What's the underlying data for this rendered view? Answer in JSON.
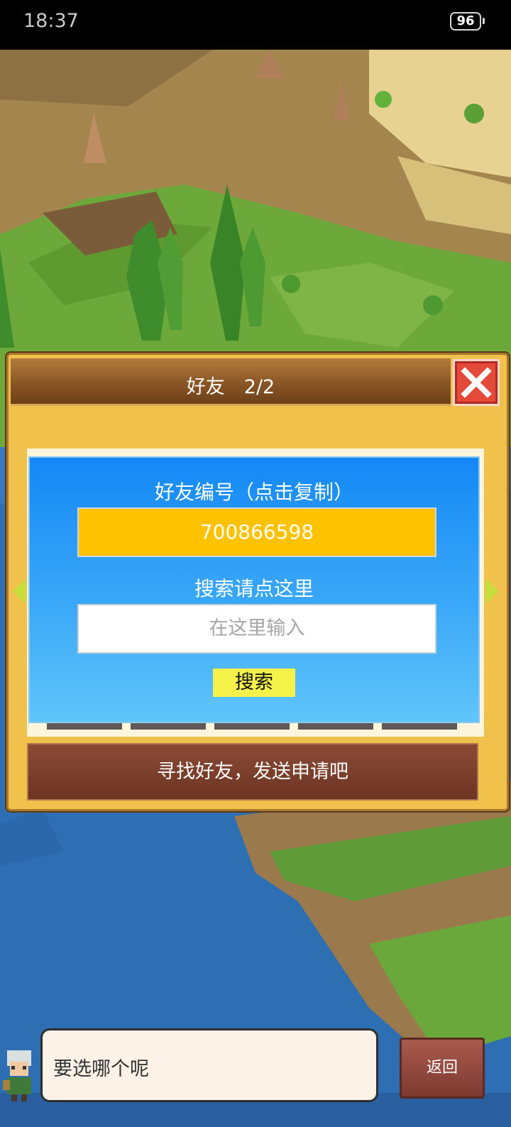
{
  "status_bar": {
    "time": "18:37",
    "battery": "96"
  },
  "panel": {
    "title": "好友　2/2",
    "friend_id_label": "好友编号（点击复制）",
    "friend_id": "700866598",
    "search_label": "搜索请点这里",
    "search_placeholder": "在这里输入",
    "search_button": "搜索",
    "find_friends_button": "寻找好友，发送申请吧"
  },
  "dialog": {
    "message": "要选哪个呢"
  },
  "back_button": "返回",
  "colors": {
    "panel_bg": "#f0c24c",
    "card_blue": "#1488f5",
    "id_box": "#ffc200",
    "search_button": "#f5f24a",
    "close_red": "#e44a3a"
  }
}
